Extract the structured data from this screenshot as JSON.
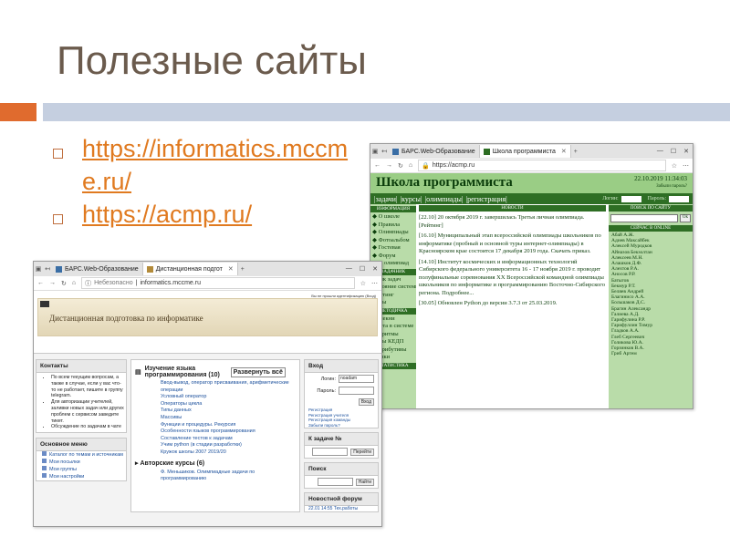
{
  "slide": {
    "title": "Полезные сайты",
    "links": [
      "https://informatics.mccme.ru/",
      "https://acmp.ru/"
    ]
  },
  "acmp": {
    "tab1": "БАРС.Web-Образование",
    "tab2": "Школа программиста",
    "url": "https://acmp.ru",
    "logo": "Школа программиста",
    "date": "22.10.2019 11:34:03",
    "forgot": "Забыли пароль?",
    "nav": [
      "задачи",
      "курсы",
      "олимпиады",
      "регистрация"
    ],
    "login_label": "Логин:",
    "password_label": "Пароль:",
    "left_head": "ИНФОРМАЦИЯ",
    "left_items": [
      "О школе",
      "Правила",
      "Олимпиады",
      "Фотоальбом",
      "Гостевая",
      "Форум",
      "...ия олимпиад"
    ],
    "tasks_head": "ЗАДАЧНИК",
    "tasks_items": [
      "...ник задач",
      "...стояние системы",
      "...ейтинг",
      "...ары"
    ],
    "method_head": "МЕТОДИЧКА",
    "method_items": [
      "...ичекни",
      "...бота в системе",
      "...горитмы",
      "...рсы КЕДП",
      "...стрибутивы",
      "...ылки"
    ],
    "stat_head": "СТАТИСТИКА",
    "news_head": "НОВОСТИ",
    "news": [
      "[22.10] 20 октября 2019 г. завершилась Третья личная олимпиада. [Рейтинг]",
      "[16.10] Муниципальный этап всероссийской олимпиады школьников по информатике (пробный и основной туры интернет-олимпиады) в Красноярском крае состоится 17 декабря 2019 года. Скачать приказ.",
      "[14.10] Институт космических и информационных технологий Сибирского федерального университета 16 - 17 ноября 2019 г. проводит полуфинальные соревнования XX Всероссийской командной олимпиады школьников по информатике и программированию Восточно-Сибирского региона. Подробнее...",
      "[30.05] Обновлен Python до версии 3.7.3 от 25.03.2019."
    ],
    "search_head": "ПОИСК ПО САЙТУ",
    "search_btn": "Ok",
    "online_head": "СЕЙЧАС В ONLINE",
    "online": [
      "Абай А.Ж.",
      "Адиев Максайбек",
      "Алексей Муродков",
      "Айназов Бекзолтан",
      "Алексеев М.Н.",
      "Алашков Д.Ф.",
      "Алехтов Р.А.",
      "Аносов Р.Р.",
      "Батыгов",
      "Бекмур Р.Т.",
      "Беляев Андрей",
      "Благинисо А.А.",
      "Большаков Д.С.",
      "Брагин Александр",
      "Галиева А.Д.",
      "Гарифулина Р.Р.",
      "Гарифуллин Тимур",
      "Гладков А.А.",
      "Глеб Сергеевич",
      "Голикова Ю.А.",
      "Горзинков В.А.",
      "Гриб Артем"
    ]
  },
  "informatics": {
    "tab1": "БАРС.Web-Образование",
    "tab2": "Дистанционная подгот",
    "not_secure": "Небезопасно",
    "url": "informatics.mccme.ru",
    "logo": "Дистанционная подготовка по информатике",
    "login_note": "Вы не прошли идентификацию (Вход)",
    "contacts_head": "Контакты",
    "contacts": [
      "По всем текущим вопросам, а также в случае, если у вас что-то не работает, пишите в группу telegram.",
      "Для авторизации учителей, заливки новых задач или других проблем с сервисом заведите тикет.",
      "Обсуждение по задачам в чате"
    ],
    "menu_head": "Основное меню",
    "menu": [
      "Каталог по темам и источникам",
      "Мои посылки",
      "Мои группы",
      "Мои настройки"
    ],
    "course_title": "Изучение языка программирования (10)",
    "expand": "Развернуть всё",
    "lessons": [
      "Ввод-вывод, оператор присваивания, арифметические операции",
      "Условный оператор",
      "Операторы цикла",
      "Типы данных",
      "Массивы",
      "Функции и процедуры. Рекурсия",
      "Особенности языков программирования",
      "Составление тестов к задачам",
      "Учим python (в стадии разработки)",
      "Кружок школы 2007 2019/20"
    ],
    "authored": "Авторские курсы (6)",
    "authored_item": "Ф. Меньшиков. Олимпиадные задачи по программированию",
    "login_head": "Вход",
    "login_label": "Логин:",
    "login_value": "noadam",
    "password_label": "Пароль:",
    "login_btn": "Вход",
    "reg_links": [
      "Регистрация",
      "Регистрация учителя",
      "Регистрация команды",
      "Забыли пароль?"
    ],
    "task_head": "К задаче №",
    "go_btn": "Перейти",
    "search_head": "Поиск",
    "search_btn": "Найти",
    "forum_head": "Новостной форум",
    "forum_item": "22.01 14:55 Тех.работы"
  }
}
